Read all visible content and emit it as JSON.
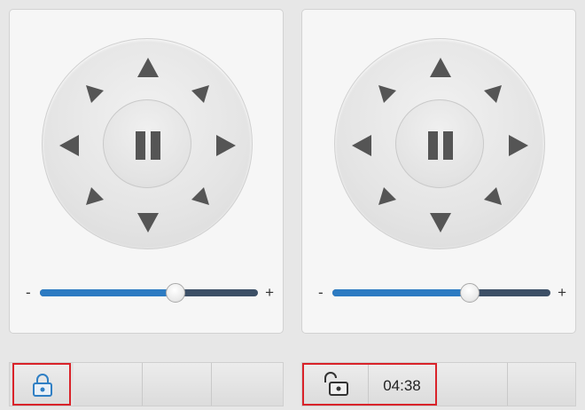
{
  "left_panel": {
    "slider": {
      "min_label": "-",
      "max_label": "+",
      "value_percent": 62
    }
  },
  "right_panel": {
    "slider": {
      "min_label": "-",
      "max_label": "+",
      "value_percent": 63
    }
  },
  "left_toolbar": {
    "lock_icon": "lock-closed-icon",
    "highlight_color": "#d9232a"
  },
  "right_toolbar": {
    "lock_icon": "lock-open-icon",
    "timer": "04:38",
    "highlight_color": "#d9232a"
  },
  "colors": {
    "slider_fill": "#2c7bc2",
    "slider_track": "#3c4f66",
    "arrow": "#555555",
    "lock_icon": "#2f7fc4"
  }
}
